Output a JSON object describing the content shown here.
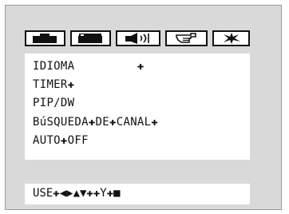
{
  "tabs": [
    {
      "icon": "tv-screen-icon"
    },
    {
      "icon": "tv-screen-alt-icon"
    },
    {
      "icon": "speaker-volume-icon"
    },
    {
      "icon": "hand-pointer-icon"
    },
    {
      "icon": "star-burst-icon"
    }
  ],
  "menu": {
    "items": [
      {
        "label": "IDIOMA         ✚"
      },
      {
        "label": "TIMER✚"
      },
      {
        "label": "PIP/DW"
      },
      {
        "label": "BúSQUEDA✚DE✚CANAL✚"
      },
      {
        "label": "AUTO✚OFF"
      }
    ]
  },
  "footer": {
    "hint": "USE✚◀▶▲▼✚✚Y✚■"
  }
}
